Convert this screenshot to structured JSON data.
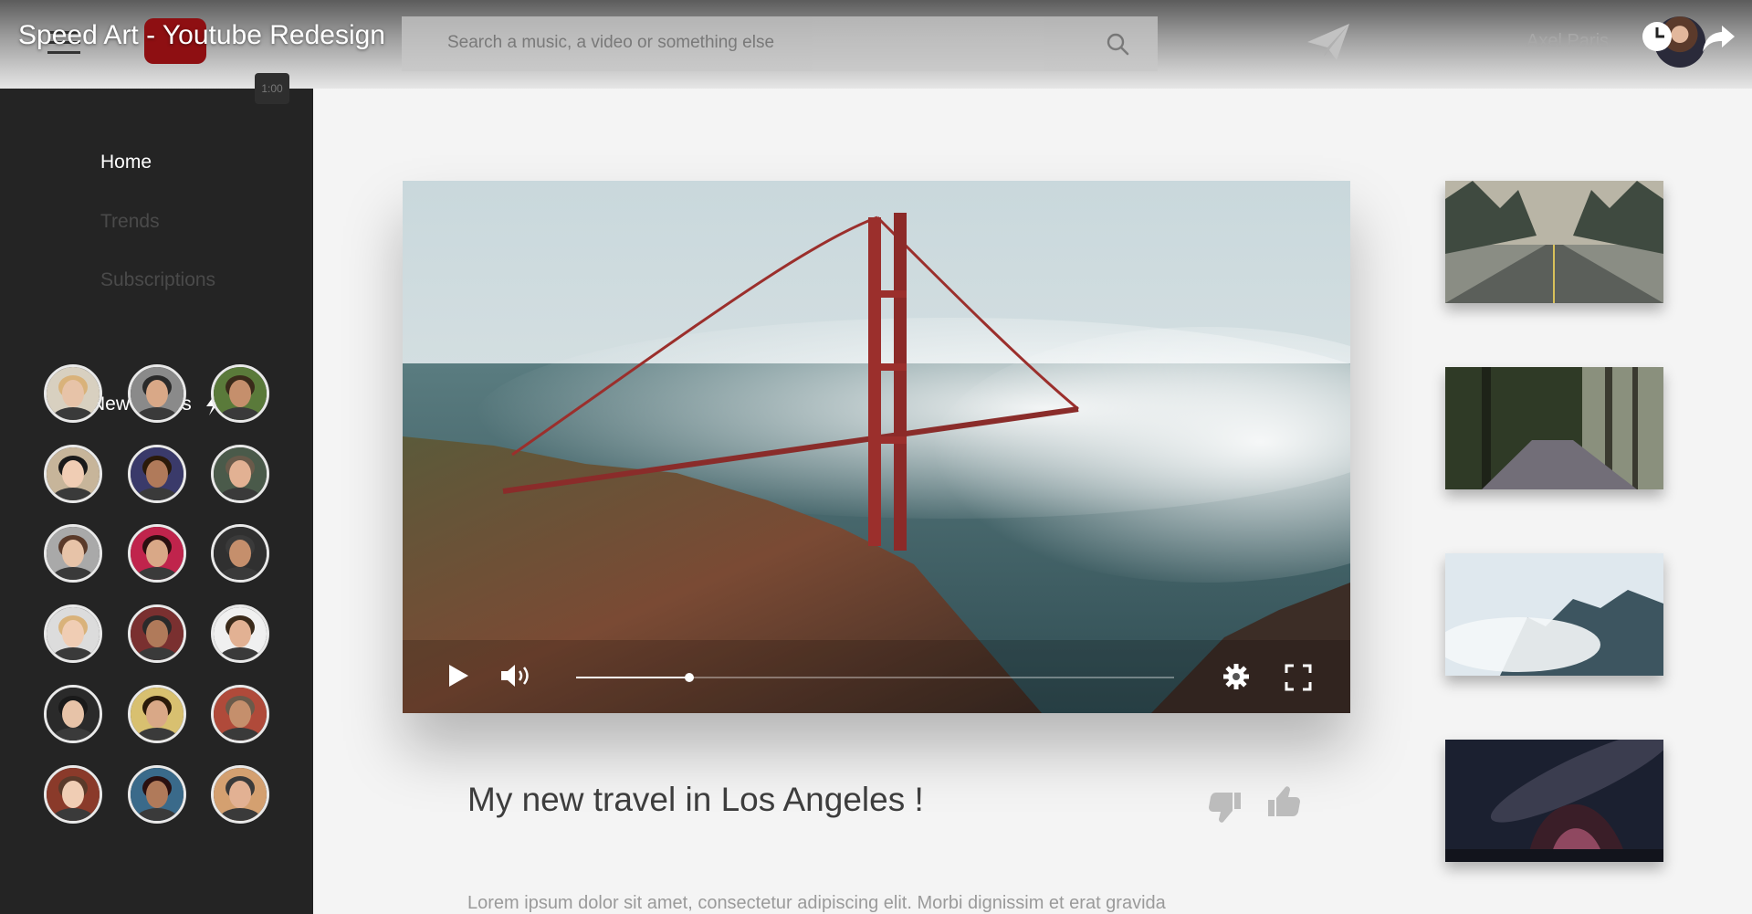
{
  "video": {
    "title": "Speed Art - Youtube Redesign",
    "badge": "1:00"
  },
  "header": {
    "search_placeholder": "Search a music, a video or something else",
    "user_name": "Axel Paris"
  },
  "sidebar": {
    "items": [
      {
        "label": "Home",
        "active": true
      },
      {
        "label": "Trends",
        "active": false
      },
      {
        "label": "Subscriptions",
        "active": false
      }
    ],
    "talents_title": "New talents"
  },
  "player": {
    "progress": 0.19
  },
  "main": {
    "title": "My new travel in Los Angeles !",
    "description": "Lorem ipsum dolor sit amet, consectetur adipiscing elit. Morbi dignissim et erat gravida"
  },
  "icons": [
    "menu-icon",
    "search-icon",
    "send-icon",
    "clock-icon",
    "share-icon",
    "bolt-icon",
    "play-icon",
    "volume-icon",
    "settings-icon",
    "fullscreen-icon",
    "thumbs-down-icon",
    "thumbs-up-icon"
  ],
  "colors": {
    "sidebar": "#242424",
    "accent": "#8e0f12",
    "bridge": "#9b2f2c"
  }
}
